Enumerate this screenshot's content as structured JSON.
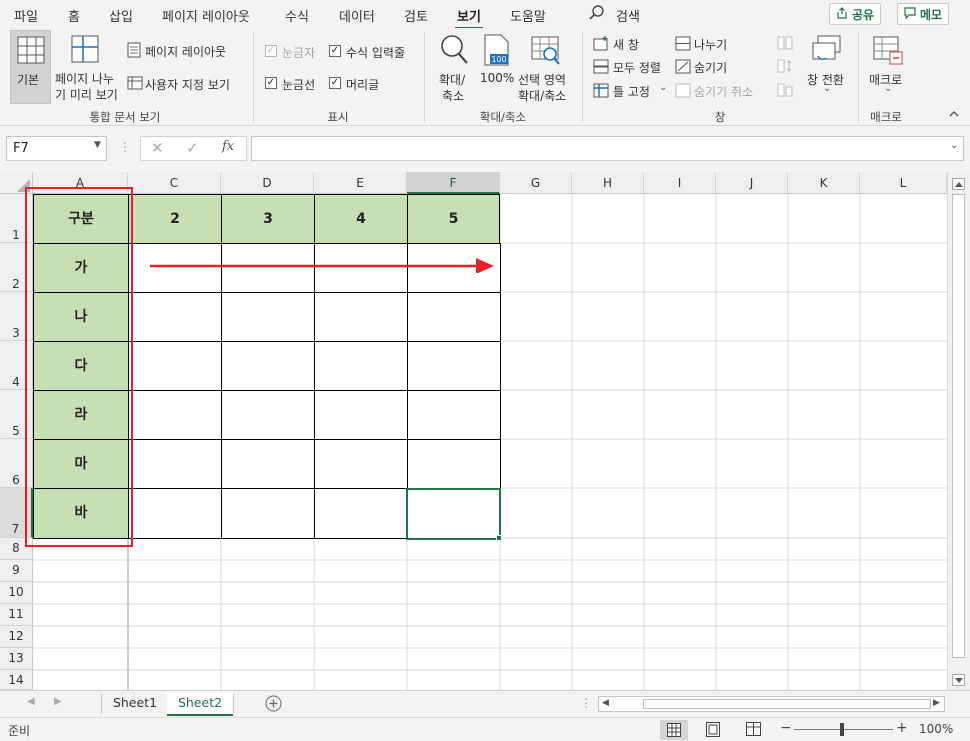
{
  "menu": {
    "tabs": [
      "파일",
      "홈",
      "삽입",
      "페이지 레이아웃",
      "수식",
      "데이터",
      "검토",
      "보기",
      "도움말"
    ],
    "search_label": "검색",
    "share_label": "공유",
    "memo_label": "메모"
  },
  "ribbon": {
    "workbook_views": {
      "normal": "기본",
      "page_break_line1": "페이지 나누",
      "page_break_line2": "기 미리 보기",
      "page_layout": "페이지 레이아웃",
      "custom_views": "사용자 지정 보기",
      "group_label": "통합 문서 보기"
    },
    "show": {
      "ruler": "눈금자",
      "formula_bar": "수식 입력줄",
      "gridlines": "눈금선",
      "headings": "머리글",
      "group_label": "표시"
    },
    "zoom": {
      "zoom_line1": "확대/",
      "zoom_line2": "축소",
      "hundred": "100%",
      "zoom_sel_line1": "선택 영역",
      "zoom_sel_line2": "확대/축소",
      "group_label": "확대/축소"
    },
    "window": {
      "new_window": "새 창",
      "arrange_all": "모두 정렬",
      "freeze_panes": "틀 고정",
      "split": "나누기",
      "hide": "숨기기",
      "unhide": "숨기기 취소",
      "switch_windows": "창 전환",
      "group_label": "창"
    },
    "macros": {
      "macros": "매크로",
      "group_label": "매크로"
    }
  },
  "formula_bar": {
    "name_box": "F7",
    "value": ""
  },
  "grid": {
    "columns": [
      "A",
      "C",
      "D",
      "E",
      "F",
      "G",
      "H",
      "I",
      "J",
      "K",
      "L"
    ],
    "rows": [
      "1",
      "2",
      "3",
      "4",
      "5",
      "6",
      "7",
      "8",
      "9",
      "10",
      "11",
      "12",
      "13",
      "14"
    ],
    "selected_column": "F",
    "selected_cell": "F7",
    "table": {
      "header": [
        "구분",
        "2",
        "3",
        "4",
        "5"
      ],
      "row_labels": [
        "가",
        "나",
        "다",
        "라",
        "마",
        "바"
      ]
    }
  },
  "sheets": [
    "Sheet1",
    "Sheet2"
  ],
  "active_sheet": "Sheet2",
  "status": {
    "ready": "준비",
    "zoom": "100%"
  },
  "colors": {
    "excel_green": "#217346",
    "header_fill": "#c6e0b4",
    "annotation_red": "#e8202a"
  }
}
